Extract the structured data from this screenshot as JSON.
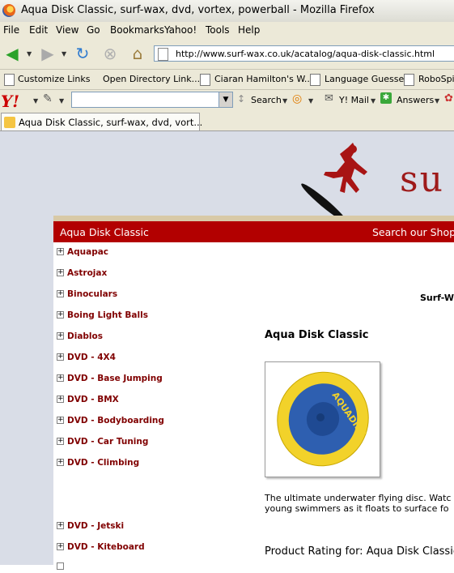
{
  "window": {
    "title": "Aqua Disk Classic, surf-wax, dvd, vortex, powerball - Mozilla Firefox"
  },
  "menu": [
    "File",
    "Edit",
    "View",
    "Go",
    "Bookmarks",
    "Yahoo!",
    "Tools",
    "Help"
  ],
  "address": {
    "url": "http://www.surf-wax.co.uk/acatalog/aqua-disk-classic.html"
  },
  "bookmarks": [
    "Customize Links",
    "Open Directory Link...",
    "Ciaran Hamilton's W...",
    "Language Guesser",
    "RoboSpic"
  ],
  "yahoo_toolbar": {
    "search_label": "Search",
    "mail_label": "Y! Mail",
    "answers_label": "Answers",
    "search_value": ""
  },
  "tab": {
    "title": "Aqua Disk Classic, surf-wax, dvd, vort..."
  },
  "site": {
    "logo_text": "su",
    "header_left": "Aqua Disk Classic",
    "header_right": "Search our Shop",
    "shop_name": "Surf-W"
  },
  "sidebar": {
    "items": [
      "Aquapac",
      "Astrojax",
      "Binoculars",
      "Boing Light Balls",
      "Diablos",
      "DVD - 4X4",
      "DVD - Base Jumping",
      "DVD - BMX",
      "DVD - Bodyboarding",
      "DVD - Car Tuning",
      "DVD - Climbing",
      "DVD - Jetski",
      "DVD - Kiteboard"
    ]
  },
  "product": {
    "title": "Aqua Disk Classic",
    "image_text": "AQUADISK",
    "desc_line1": "The ultimate underwater flying disc. Watc",
    "desc_line2": "young swimmers as it floats to surface fo",
    "rating_label": "Product Rating for: Aqua Disk Classic"
  },
  "colors": {
    "header_red": "#b20000",
    "link_maroon": "#800000",
    "page_bg": "#d9dde7",
    "disc_yellow": "#f2d22a",
    "disc_blue": "#2e5fb0"
  }
}
